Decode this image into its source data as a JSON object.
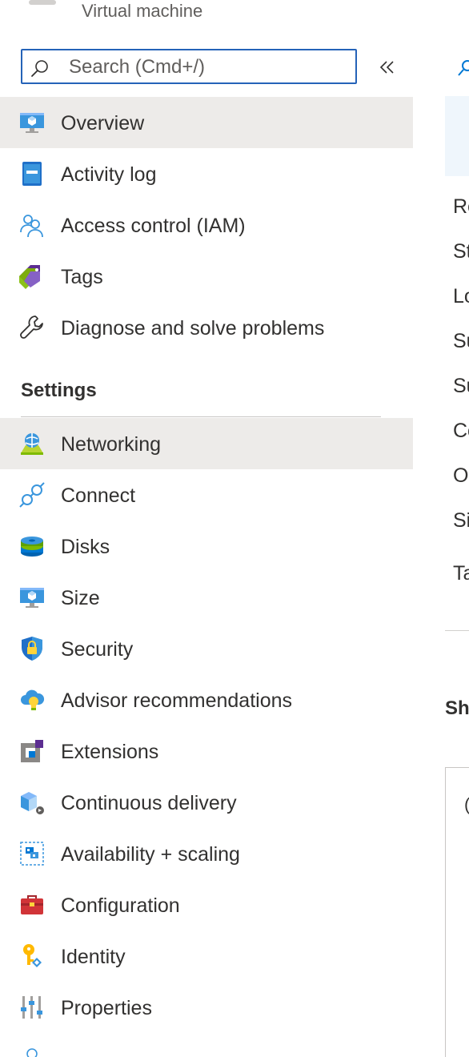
{
  "header": {
    "resource_type": "Virtual machine"
  },
  "search": {
    "placeholder": "Search (Cmd+/)",
    "value": ""
  },
  "nav_top": [
    {
      "label": "Overview",
      "icon": "vm-monitor-icon",
      "selected": true
    },
    {
      "label": "Activity log",
      "icon": "activity-log-icon"
    },
    {
      "label": "Access control (IAM)",
      "icon": "people-icon"
    },
    {
      "label": "Tags",
      "icon": "tag-icon"
    },
    {
      "label": "Diagnose and solve problems",
      "icon": "wrench-icon"
    }
  ],
  "settings": {
    "header": "Settings",
    "items": [
      {
        "label": "Networking",
        "icon": "networking-icon",
        "selected": true
      },
      {
        "label": "Connect",
        "icon": "plug-icon"
      },
      {
        "label": "Disks",
        "icon": "disks-icon"
      },
      {
        "label": "Size",
        "icon": "vm-monitor-icon"
      },
      {
        "label": "Security",
        "icon": "shield-lock-icon"
      },
      {
        "label": "Advisor recommendations",
        "icon": "advisor-cloud-icon"
      },
      {
        "label": "Extensions",
        "icon": "extensions-icon"
      },
      {
        "label": "Continuous delivery",
        "icon": "continuous-delivery-icon"
      },
      {
        "label": "Availability + scaling",
        "icon": "availability-scaling-icon"
      },
      {
        "label": "Configuration",
        "icon": "toolbox-icon"
      },
      {
        "label": "Identity",
        "icon": "key-icon"
      },
      {
        "label": "Properties",
        "icon": "properties-sliders-icon"
      }
    ]
  },
  "main": {
    "property_labels": [
      "Re",
      "St",
      "Lo",
      "Su",
      "Su",
      "Co",
      "O",
      "Si",
      "Ta"
    ],
    "section_partial": "Sh",
    "card_char": "("
  },
  "colors": {
    "accent": "#0078d4",
    "search_border": "#2563b8",
    "selected_bg": "#edebe9"
  }
}
